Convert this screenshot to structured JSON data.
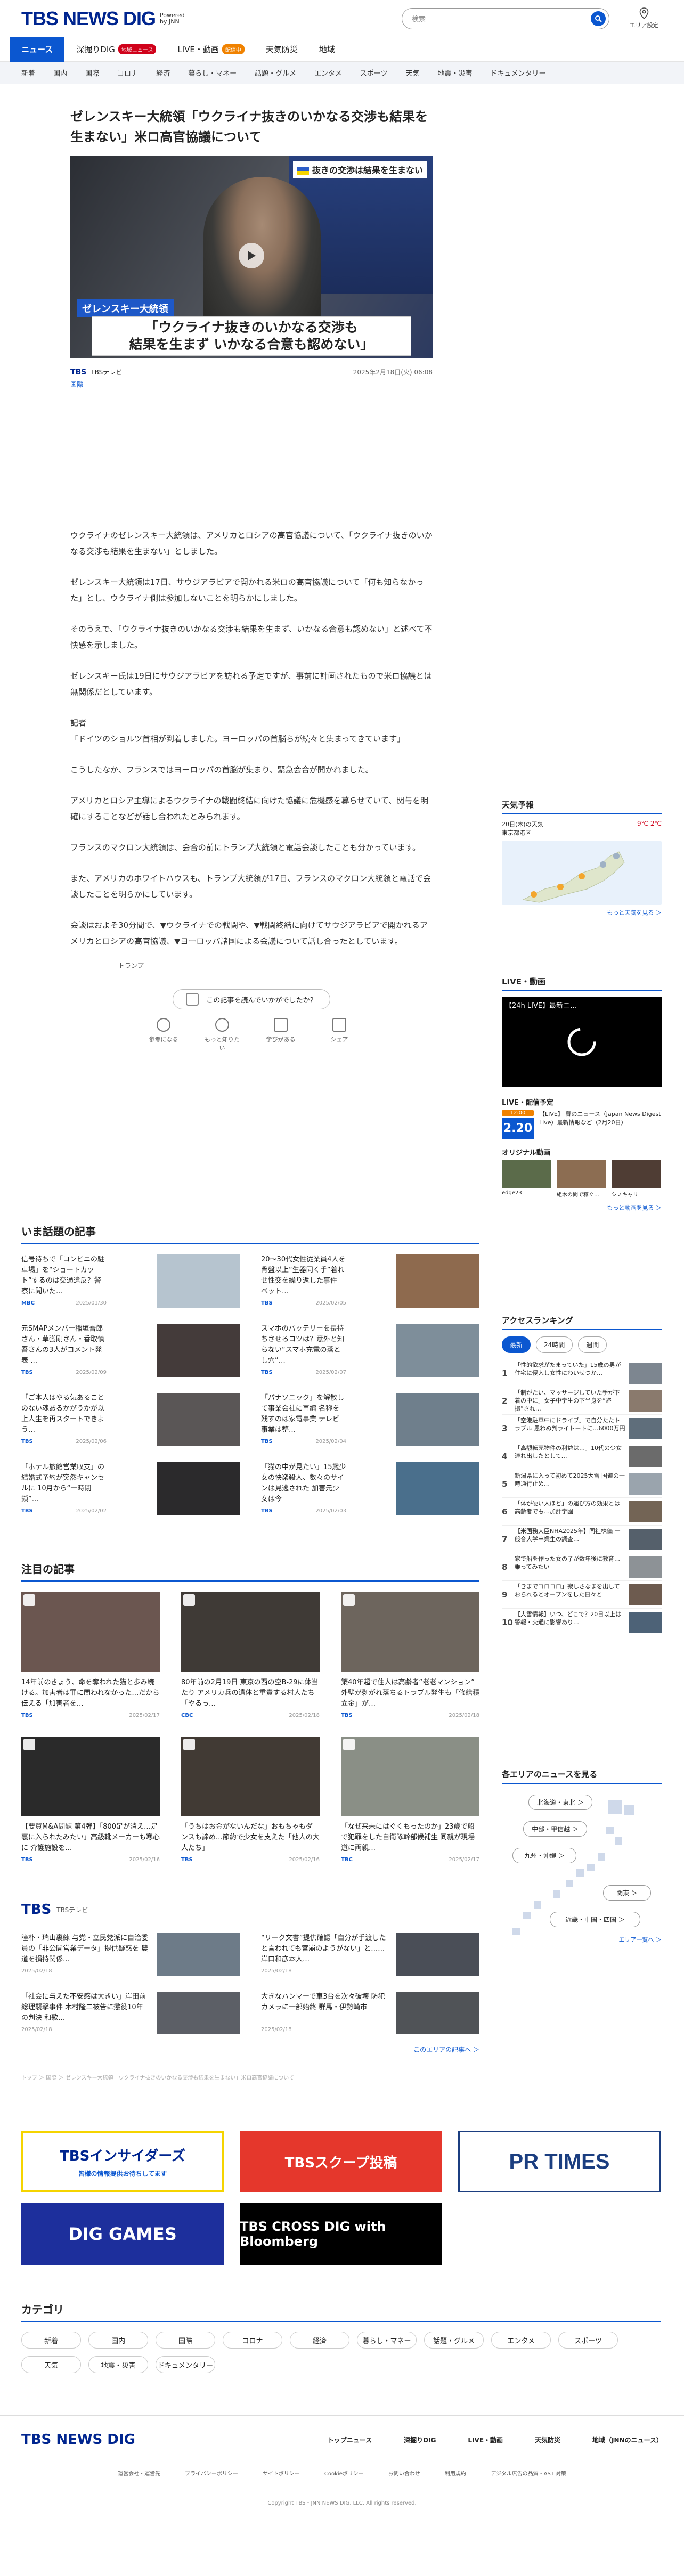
{
  "header": {
    "logo": "TBS NEWS DIG",
    "powered": "Powered by JNN",
    "search_placeholder": "検索",
    "area_label": "エリア設定"
  },
  "nav_main": [
    {
      "label": "ニュース",
      "active": true
    },
    {
      "label": "深掘りDIG",
      "badge": "地域ニュース",
      "badge_color": "#d0021b"
    },
    {
      "label": "LIVE・動画",
      "badge": "配信中",
      "badge_color": "#f08200"
    },
    {
      "label": "天気防災"
    },
    {
      "label": "地域"
    }
  ],
  "nav_sub": [
    "新着",
    "国内",
    "国際",
    "コロナ",
    "経済",
    "暮らし・マネー",
    "話題・グルメ",
    "エンタメ",
    "スポーツ",
    "天気",
    "地震・災害",
    "ドキュメンタリー"
  ],
  "article": {
    "title": "ゼレンスキー大統領「ウクライナ抜きのいかなる交渉も結果を生まない」米ロ高官協議について",
    "hero_tag": "抜きの交渉は結果を生まない",
    "hero_cap1": "ゼレンスキー大統領",
    "hero_cap2a": "「ウクライナ抜きのいかなる交渉も",
    "hero_cap2b": "結果を生まず いかなる合意も認めない」",
    "source": "TBS",
    "source_sub": "TBSテレビ",
    "date": "2025年2月18日(火) 06:08",
    "category": "国際",
    "paragraphs": [
      "ウクライナのゼレンスキー大統領は、アメリカとロシアの高官協議について、「ウクライナ抜きのいかなる交渉も結果を生まない」としました。",
      "ゼレンスキー大統領は17日、サウジアラビアで開かれる米ロの高官協議について「何も知らなかった」とし、ウクライナ側は参加しないことを明らかにしました。",
      "そのうえで、「ウクライナ抜きのいかなる交渉も結果を生まず、いかなる合意も認めない」と述べて不快感を示しました。",
      "ゼレンスキー氏は19日にサウジアラビアを訪れる予定ですが、事前に計画されたもので米ロ協議とは無関係だとしています。",
      "記者\n「ドイツのショルツ首相が到着しました。ヨーロッパの首脳らが続々と集まってきています」",
      "こうしたなか、フランスではヨーロッパの首脳が集まり、緊急会合が開かれました。",
      "アメリカとロシア主導によるウクライナの戦闘終結に向けた協議に危機感を募らせていて、関与を明確にすることなどが話し合われたとみられます。",
      "フランスのマクロン大統領は、会合の前にトランプ大統領と電話会談したことも分かっています。",
      "また、アメリカのホワイトハウスも、トランプ大統領が17日、フランスのマクロン大統領と電話で会談したことを明らかにしています。",
      "会談はおよそ30分間で、▼ウクライナでの戦闘や、▼戦闘終結に向けてサウジアラビアで開かれるアメリカとロシアの高官協議、▼ヨーロッパ諸国による会議について話し合ったとしています。"
    ],
    "tag": "トランプ",
    "feedback_q": "この記事を読んでいかがでしたか？",
    "feedback": [
      "参考になる",
      "もっと知りたい",
      "学びがある",
      "シェア"
    ]
  },
  "trending": {
    "title": "いま話題の記事",
    "items": [
      {
        "title": "信号待ちで「コンビニの駐車場」を“ショートカット”するのは交通違反？警察に聞いた…",
        "src": "MBC",
        "date": "2025/01/30",
        "color": "#b6c4cf"
      },
      {
        "title": "20～30代女性従業員4人を骨盤以上“生器同く手”着れせ性交を繰り返した事件 ペット…",
        "src": "TBS",
        "date": "2025/02/05",
        "color": "#8e6a4e"
      },
      {
        "title": "元SMAPメンバー稲垣吾郎さん・草彅剛さん・香取慎吾さんの3人がコメント発表 …",
        "src": "TBS",
        "date": "2025/02/09",
        "color": "#443b3a"
      },
      {
        "title": "スマホのバッテリーを長持ちさせるコツは？意外と知らない“スマホ充電の落とし穴”…",
        "src": "TBS",
        "date": "2025/02/07",
        "color": "#7e8e9a"
      },
      {
        "title": "「ご本人はやる気あることのない魂あるかがうかが以上人生を再スタートできよう…",
        "src": "TBS",
        "date": "2025/02/06",
        "color": "#5a5656"
      },
      {
        "title": "「パナソニック」を解散して事業会社に再編 名称を残すのは家電事業 テレビ事業は整…",
        "src": "TBS",
        "date": "2025/02/04",
        "color": "#6f7f8c"
      },
      {
        "title": "「ホテル旅館営業収支」の結婚式予約が突然キャンセルに 10月から“一時閉鎖”…",
        "src": "TBS",
        "date": "2025/02/02",
        "color": "#2b2a2c"
      },
      {
        "title": "「猫の中が見たい」15歳少女の快楽殺人、数々のサインは見逃された 加害元少女は今",
        "src": "TBS",
        "date": "2025/02/03",
        "color": "#4a6f8c"
      }
    ]
  },
  "featured": {
    "title": "注目の記事",
    "items": [
      {
        "title": "14年前のきょう、命を奪われた猫と歩み続ける。加害者は罪に問われなかった…だから伝える「加害者を…",
        "src": "TBS",
        "date": "2025/02/17",
        "color": "#6b5650"
      },
      {
        "title": "80年前の2月19日 東京の西の空B-29に体当たり アメリカ兵の遺体と重責する村人たち 「やるっ…",
        "src": "CBC",
        "date": "2025/02/18",
        "color": "#3f3a36"
      },
      {
        "title": "築40年超で住人は高齢者“老老マンション” 外壁が剥がれ落ちるトラブル発生も「修繕積立金」が…",
        "src": "TBS",
        "date": "2025/02/18",
        "color": "#6d655d"
      },
      {
        "title": "【要買M&A問題 第4弾】「800足が消え…足裏に入られたみたい」高級靴メーカーも寒心に 介護施設を…",
        "src": "TBS",
        "date": "2025/02/16",
        "color": "#2a2a2a"
      },
      {
        "title": "「うちはお金がないんだな」おもちゃもダンスも諦め…節約で少女を支えた「他人の大人たち」",
        "src": "TBS",
        "date": "2025/02/16",
        "color": "#413a34"
      },
      {
        "title": "「なぜ来未にはぐくもったのか」23歳で船で犯罪をした自衛隊幹部候補生 同親が現場道に両親…",
        "src": "TBC",
        "date": "2025/02/17",
        "color": "#8a8f86"
      }
    ]
  },
  "tbs_section": {
    "logo": "TBS",
    "sub": "TBSテレビ",
    "items": [
      {
        "title": "瞳朴・瑞山裏練 与党・立民党派に自治委員の「非公開営業データ」提供疑惑を 農道を損持関係…",
        "date": "2025/02/18",
        "color": "#6d7b88"
      },
      {
        "title": "“リーク文書”提供確認「自分が手渡したと言われても宮崩のようがない」と……岸口和彦本人…",
        "date": "2025/02/18",
        "color": "#4a4e57"
      },
      {
        "title": "「社会に与えた不安感は大きい」岸田前総理襲撃事件 木村隆二被告に懲役10年の判決 和歌…",
        "date": "2025/02/18",
        "color": "#5c5f66"
      },
      {
        "title": "大きなハンマーで車3台を次々破壊 防犯カメラに一部始終 群馬・伊勢崎市",
        "date": "2025/02/18",
        "color": "#505357"
      }
    ],
    "more": "このエリアの記事へ ＞"
  },
  "breadcrumb": "トップ ＞ 国際 ＞ ゼレンスキー大統領「ウクライナ抜きのいかなる交渉も結果を生まない」米ロ高官協議について",
  "side": {
    "weather_title": "天気予報",
    "weather_date": "20日(木)の天気",
    "weather_area": "東京都港区",
    "weather_temp": "9℃ 2℃",
    "weather_more": "もっと天気を見る ＞",
    "live_title": "LIVE・動画",
    "live_caption": "【24h LIVE】最新ニ…",
    "live_sched_title": "LIVE・配信予定",
    "live_item_badge": "12:00",
    "live_item_title": "【LIVE】 暮のニュース（Japan News Digest Live）最新情報など（2月20日）",
    "live_item_date": "2.20",
    "original_title": "オリジナル動画",
    "originals": [
      {
        "t": "edge23",
        "c": "#5b6b4a"
      },
      {
        "t": "組木の聞で稼ぐ…",
        "c": "#8c6d52"
      },
      {
        "t": "シノキャリ",
        "c": "#4f3d34"
      }
    ],
    "original_more": "もっと動画を見る ＞",
    "ranking_title": "アクセスランキング",
    "ranking_tabs": [
      "最新",
      "24時間",
      "週間"
    ],
    "ranking": [
      {
        "n": "1",
        "t": "「性的欲求がたまっていた」15歳の男が住宅に侵入し女性にわいせつか…",
        "c": "#7d8690"
      },
      {
        "n": "2",
        "t": "「制がたい、マッサージしていた手が下着の中に」女子中学生の下半身を“盗撮”され…",
        "c": "#8a7a6d"
      },
      {
        "n": "3",
        "t": "「空港駐車中にドライブ」で自分たたトラブル 思わぬ判ライトートに…6000万円",
        "c": "#5f6e7b"
      },
      {
        "n": "4",
        "t": "「高額転売物件の利益は…」10代の少女連れ出したとして…",
        "c": "#6b6b6b"
      },
      {
        "n": "5",
        "t": "新潟県に入って初めて2025大雪 国道の一時通行止め…",
        "c": "#9aa4ad"
      },
      {
        "n": "6",
        "t": "「体が硬い人ほど」の運び方の効果とは 高齢者でも…加計学園",
        "c": "#736455"
      },
      {
        "n": "7",
        "t": "【米国務大臣NHA2025年】同社株価 一般合大学卒業生の調査…",
        "c": "#55606b"
      },
      {
        "n": "8",
        "t": "家で船を作った女の子が数年後に教育…乗ってみたい",
        "c": "#8d9296"
      },
      {
        "n": "9",
        "t": "「きまでコロコロ」寂しさなまを出しておられるとオープンをした日々と",
        "c": "#6d5b4f"
      },
      {
        "n": "10",
        "t": "【大雪情報】いつ、どこで？20日以上は警報・交通に影響あり…",
        "c": "#4d6277"
      }
    ],
    "area_title": "各エリアのニュースを見る",
    "area_pills": [
      "北海道・東北 ＞",
      "中部・甲信越 ＞",
      "九州・沖縄 ＞",
      "関東 ＞",
      "近畿・中国・四国 ＞"
    ],
    "area_more": "エリア一覧へ ＞"
  },
  "banners": [
    "TBSインサイダーズ",
    "TBSスクープ投稿",
    "PR TIMES",
    "DIG GAMES",
    "TBS CROSS DIG with Bloomberg"
  ],
  "banner_sub1": "皆様の情報提供お待ちしてます",
  "categories_title": "カテゴリ",
  "categories": [
    "新着",
    "国内",
    "国際",
    "コロナ",
    "経済",
    "暮らし・マネー",
    "話題・グルメ",
    "エンタメ",
    "スポーツ",
    "天気",
    "地震・災害",
    "ドキュメンタリー"
  ],
  "footer": {
    "logo": "TBS NEWS DIG",
    "links1": [
      "トップニュース",
      "深掘りDIG",
      "LIVE・動画",
      "天気防災",
      "地域（JNNのニュース）"
    ],
    "links2": [
      "運営会社・運営先",
      "プライバシーポリシー",
      "サイトポリシー",
      "Cookieポリシー",
      "お問い合わせ",
      "利用規約",
      "デジタル広告の品質・ASTI対策"
    ],
    "copyright": "Copyright TBS・JNN NEWS DIG, LLC. All rights reserved."
  }
}
